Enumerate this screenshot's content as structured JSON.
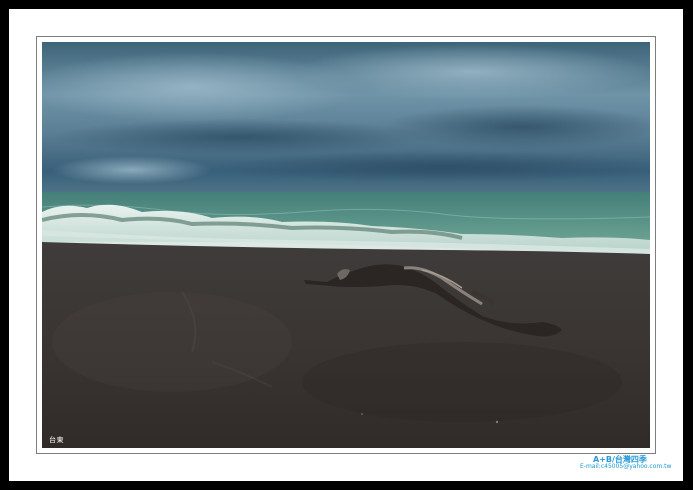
{
  "photo": {
    "caption": "台東",
    "scene": "beach-driftwood-stormy-sea"
  },
  "signature": {
    "title": "A+B/台灣四季",
    "email": "E-mail:c45005@yahoo.com.tw"
  },
  "colors": {
    "background": "#000000",
    "mat": "#ffffff",
    "sky": "#4c6f86",
    "sea": "#4f8f7e",
    "sand": "#3b3633",
    "signature_blue": "#2a9ad8"
  }
}
